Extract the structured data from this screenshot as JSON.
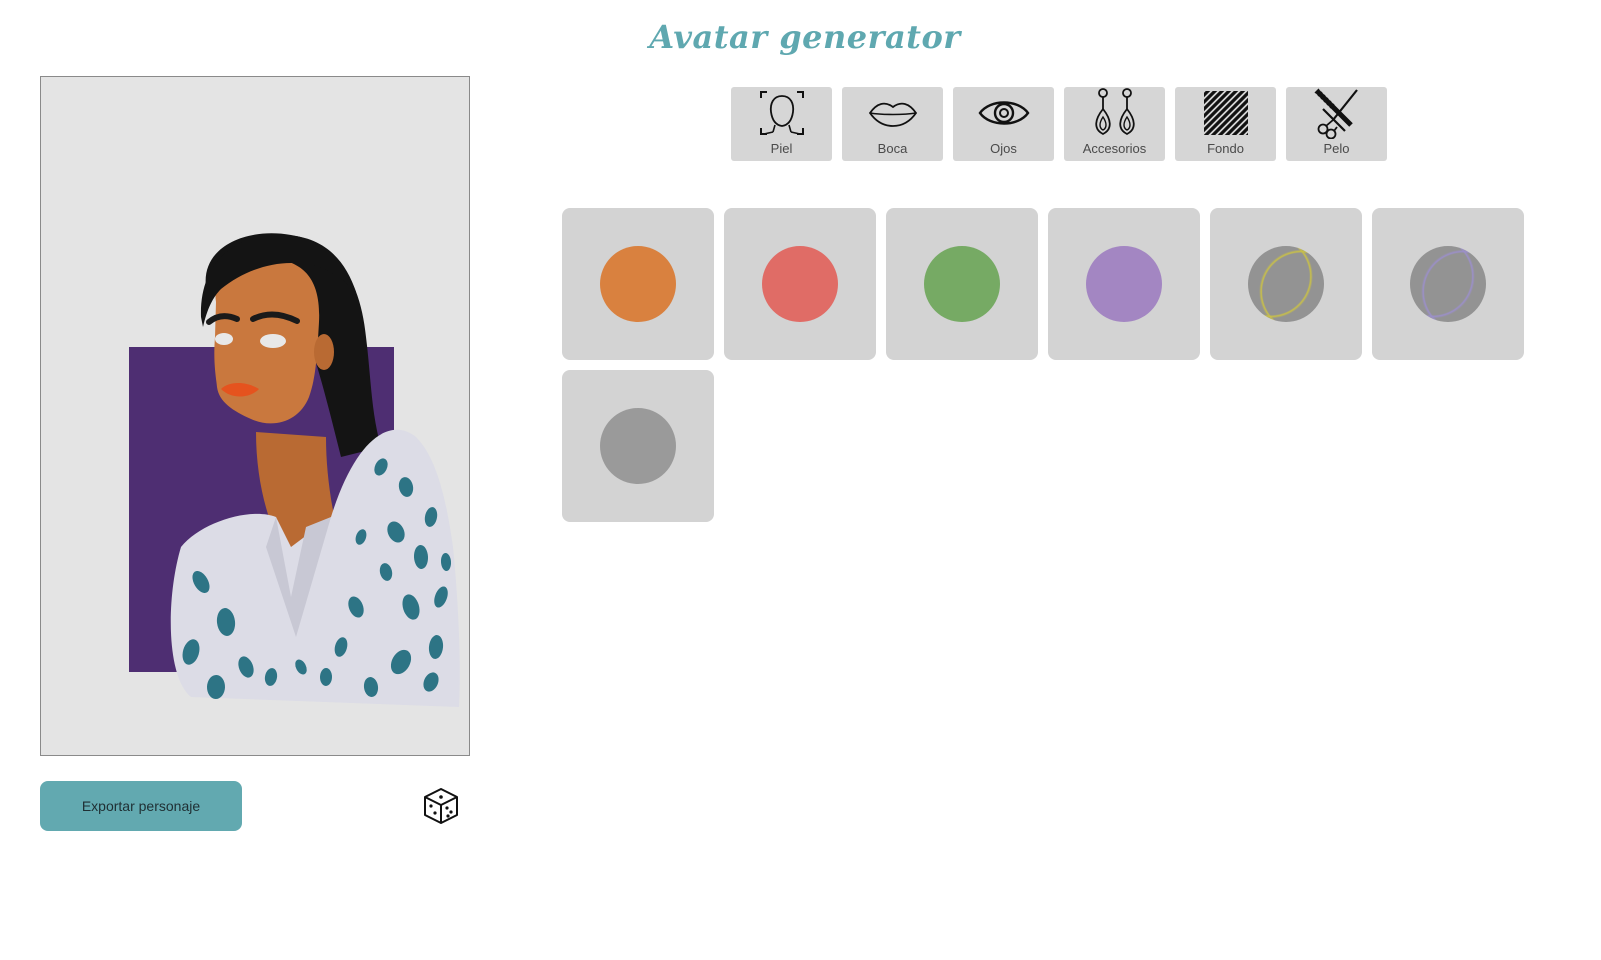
{
  "header": {
    "title": "Avatar generator"
  },
  "tabs": [
    {
      "label": "Piel",
      "icon": "face-icon"
    },
    {
      "label": "Boca",
      "icon": "lips-icon"
    },
    {
      "label": "Ojos",
      "icon": "eye-icon"
    },
    {
      "label": "Accesorios",
      "icon": "earrings-icon"
    },
    {
      "label": "Fondo",
      "icon": "stripes-icon"
    },
    {
      "label": "Pelo",
      "icon": "scissors-comb-icon"
    }
  ],
  "swatches": [
    {
      "name": "orange",
      "color": "#d9813f"
    },
    {
      "name": "coral",
      "color": "#e06c66"
    },
    {
      "name": "green",
      "color": "#76aa64"
    },
    {
      "name": "purple",
      "color": "#a386c2"
    },
    {
      "name": "gray-yellow-texture",
      "color": "#939393",
      "accent": "#c9c048"
    },
    {
      "name": "gray-purple-texture",
      "color": "#939393",
      "accent": "#9b8fc9"
    },
    {
      "name": "gray",
      "color": "#9a9a9a"
    }
  ],
  "preview": {
    "background_color": "#e4e4e4",
    "backdrop_color": "#4e2e72",
    "skin_color": "#c9783e",
    "hair_color": "#141414",
    "lips_color": "#e5531e",
    "shirt_color": "#dcdce6",
    "pattern_color": "#2d7485"
  },
  "actions": {
    "export_label": "Exportar personaje",
    "random_icon": "dice-icon"
  },
  "colors": {
    "accent": "#62a9b0",
    "tab_bg": "#d6d6d6",
    "swatch_bg": "#d3d3d3"
  }
}
